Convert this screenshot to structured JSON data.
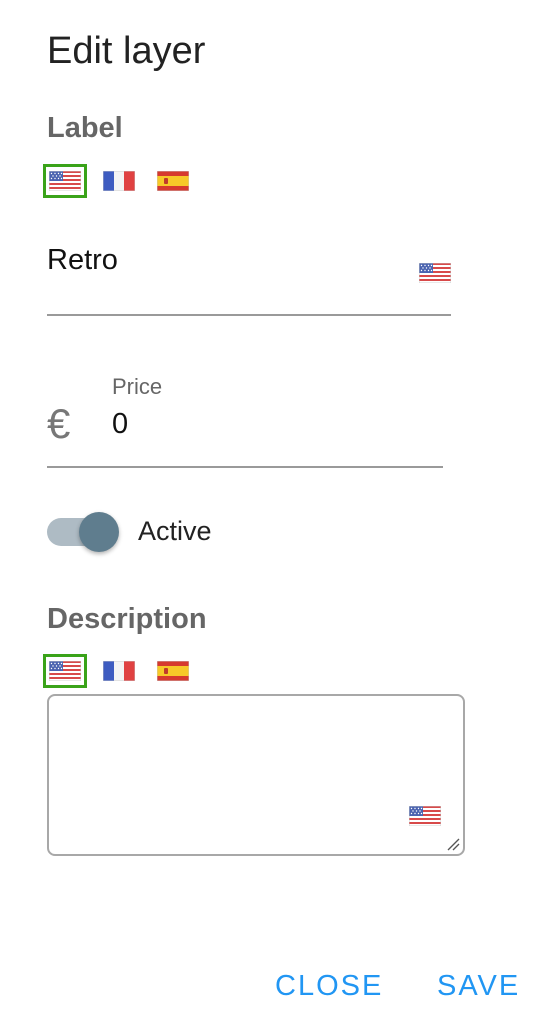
{
  "dialog": {
    "title": "Edit layer"
  },
  "label_section": {
    "heading": "Label",
    "languages": [
      {
        "code": "en",
        "flag": "us-flag-icon",
        "selected": true
      },
      {
        "code": "fr",
        "flag": "fr-flag-icon",
        "selected": false
      },
      {
        "code": "es",
        "flag": "es-flag-icon",
        "selected": false
      }
    ],
    "value": "Retro"
  },
  "price": {
    "label": "Price",
    "currency_symbol": "€",
    "value": "0"
  },
  "active_toggle": {
    "label": "Active",
    "checked": true
  },
  "description_section": {
    "heading": "Description",
    "value": ""
  },
  "actions": {
    "close_label": "CLOSE",
    "save_label": "SAVE"
  },
  "colors": {
    "accent": "#2196f3",
    "selected_flag_border": "#3aa319",
    "toggle_knob": "#5f7d8e",
    "toggle_track": "#aebbc4"
  }
}
